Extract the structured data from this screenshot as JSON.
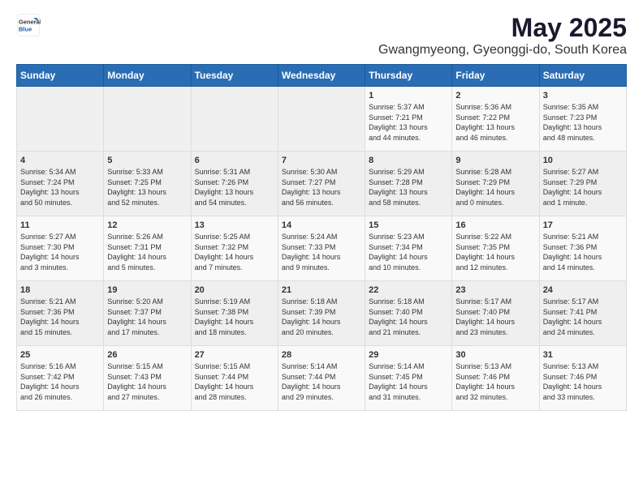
{
  "logo": {
    "general": "General",
    "blue": "Blue"
  },
  "title": "May 2025",
  "subtitle": "Gwangmyeong, Gyeonggi-do, South Korea",
  "days_of_week": [
    "Sunday",
    "Monday",
    "Tuesday",
    "Wednesday",
    "Thursday",
    "Friday",
    "Saturday"
  ],
  "weeks": [
    [
      {
        "day": "",
        "info": ""
      },
      {
        "day": "",
        "info": ""
      },
      {
        "day": "",
        "info": ""
      },
      {
        "day": "",
        "info": ""
      },
      {
        "day": "1",
        "info": "Sunrise: 5:37 AM\nSunset: 7:21 PM\nDaylight: 13 hours\nand 44 minutes."
      },
      {
        "day": "2",
        "info": "Sunrise: 5:36 AM\nSunset: 7:22 PM\nDaylight: 13 hours\nand 46 minutes."
      },
      {
        "day": "3",
        "info": "Sunrise: 5:35 AM\nSunset: 7:23 PM\nDaylight: 13 hours\nand 48 minutes."
      }
    ],
    [
      {
        "day": "4",
        "info": "Sunrise: 5:34 AM\nSunset: 7:24 PM\nDaylight: 13 hours\nand 50 minutes."
      },
      {
        "day": "5",
        "info": "Sunrise: 5:33 AM\nSunset: 7:25 PM\nDaylight: 13 hours\nand 52 minutes."
      },
      {
        "day": "6",
        "info": "Sunrise: 5:31 AM\nSunset: 7:26 PM\nDaylight: 13 hours\nand 54 minutes."
      },
      {
        "day": "7",
        "info": "Sunrise: 5:30 AM\nSunset: 7:27 PM\nDaylight: 13 hours\nand 56 minutes."
      },
      {
        "day": "8",
        "info": "Sunrise: 5:29 AM\nSunset: 7:28 PM\nDaylight: 13 hours\nand 58 minutes."
      },
      {
        "day": "9",
        "info": "Sunrise: 5:28 AM\nSunset: 7:29 PM\nDaylight: 14 hours\nand 0 minutes."
      },
      {
        "day": "10",
        "info": "Sunrise: 5:27 AM\nSunset: 7:29 PM\nDaylight: 14 hours\nand 1 minute."
      }
    ],
    [
      {
        "day": "11",
        "info": "Sunrise: 5:27 AM\nSunset: 7:30 PM\nDaylight: 14 hours\nand 3 minutes."
      },
      {
        "day": "12",
        "info": "Sunrise: 5:26 AM\nSunset: 7:31 PM\nDaylight: 14 hours\nand 5 minutes."
      },
      {
        "day": "13",
        "info": "Sunrise: 5:25 AM\nSunset: 7:32 PM\nDaylight: 14 hours\nand 7 minutes."
      },
      {
        "day": "14",
        "info": "Sunrise: 5:24 AM\nSunset: 7:33 PM\nDaylight: 14 hours\nand 9 minutes."
      },
      {
        "day": "15",
        "info": "Sunrise: 5:23 AM\nSunset: 7:34 PM\nDaylight: 14 hours\nand 10 minutes."
      },
      {
        "day": "16",
        "info": "Sunrise: 5:22 AM\nSunset: 7:35 PM\nDaylight: 14 hours\nand 12 minutes."
      },
      {
        "day": "17",
        "info": "Sunrise: 5:21 AM\nSunset: 7:36 PM\nDaylight: 14 hours\nand 14 minutes."
      }
    ],
    [
      {
        "day": "18",
        "info": "Sunrise: 5:21 AM\nSunset: 7:36 PM\nDaylight: 14 hours\nand 15 minutes."
      },
      {
        "day": "19",
        "info": "Sunrise: 5:20 AM\nSunset: 7:37 PM\nDaylight: 14 hours\nand 17 minutes."
      },
      {
        "day": "20",
        "info": "Sunrise: 5:19 AM\nSunset: 7:38 PM\nDaylight: 14 hours\nand 18 minutes."
      },
      {
        "day": "21",
        "info": "Sunrise: 5:18 AM\nSunset: 7:39 PM\nDaylight: 14 hours\nand 20 minutes."
      },
      {
        "day": "22",
        "info": "Sunrise: 5:18 AM\nSunset: 7:40 PM\nDaylight: 14 hours\nand 21 minutes."
      },
      {
        "day": "23",
        "info": "Sunrise: 5:17 AM\nSunset: 7:40 PM\nDaylight: 14 hours\nand 23 minutes."
      },
      {
        "day": "24",
        "info": "Sunrise: 5:17 AM\nSunset: 7:41 PM\nDaylight: 14 hours\nand 24 minutes."
      }
    ],
    [
      {
        "day": "25",
        "info": "Sunrise: 5:16 AM\nSunset: 7:42 PM\nDaylight: 14 hours\nand 26 minutes."
      },
      {
        "day": "26",
        "info": "Sunrise: 5:15 AM\nSunset: 7:43 PM\nDaylight: 14 hours\nand 27 minutes."
      },
      {
        "day": "27",
        "info": "Sunrise: 5:15 AM\nSunset: 7:44 PM\nDaylight: 14 hours\nand 28 minutes."
      },
      {
        "day": "28",
        "info": "Sunrise: 5:14 AM\nSunset: 7:44 PM\nDaylight: 14 hours\nand 29 minutes."
      },
      {
        "day": "29",
        "info": "Sunrise: 5:14 AM\nSunset: 7:45 PM\nDaylight: 14 hours\nand 31 minutes."
      },
      {
        "day": "30",
        "info": "Sunrise: 5:13 AM\nSunset: 7:46 PM\nDaylight: 14 hours\nand 32 minutes."
      },
      {
        "day": "31",
        "info": "Sunrise: 5:13 AM\nSunset: 7:46 PM\nDaylight: 14 hours\nand 33 minutes."
      }
    ]
  ]
}
